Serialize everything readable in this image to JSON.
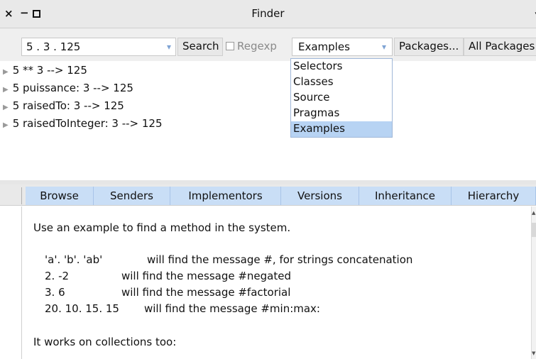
{
  "window": {
    "title": "Finder",
    "close_glyph": "×",
    "minimize_glyph": "−",
    "menu_glyph": "▾"
  },
  "toolbar": {
    "search_value": "5 . 3 . 125",
    "search_button": "Search",
    "regexp_label": "Regexp",
    "mode_value": "Examples",
    "packages_button": "Packages...",
    "all_packages_button": "All Packages",
    "dropdown_glyph": "▾"
  },
  "mode_options": [
    {
      "label": "Selectors"
    },
    {
      "label": "Classes"
    },
    {
      "label": "Source"
    },
    {
      "label": "Pragmas"
    },
    {
      "label": "Examples",
      "selected": true
    }
  ],
  "results": [
    {
      "label": "5 ** 3 --> 125"
    },
    {
      "label": "5 puissance: 3 --> 125"
    },
    {
      "label": "5 raisedTo: 3 --> 125"
    },
    {
      "label": "5 raisedToInteger: 3 --> 125"
    }
  ],
  "tabs": [
    {
      "label": "Browse"
    },
    {
      "label": "Senders"
    },
    {
      "label": "Implementors"
    },
    {
      "label": "Versions"
    },
    {
      "label": "Inheritance"
    },
    {
      "label": "Hierarchy"
    }
  ],
  "help_text": {
    "intro": "Use an example to find a method in the system.",
    "examples": [
      {
        "input": "'a'. 'b'. 'ab'",
        "description": "will find the message #, for strings concatenation"
      },
      {
        "input": "2. -2",
        "description": "will find the message #negated"
      },
      {
        "input": "3. 6",
        "description": "will find the message #factorial"
      },
      {
        "input": "20. 10. 15. 15",
        "description": "will find the message #min:max:"
      }
    ],
    "footer": "It works on collections too:"
  },
  "colors": {
    "accent": "#c9def6",
    "selection": "#b7d3f3",
    "dropdown_arrow": "#7ea3d4"
  }
}
